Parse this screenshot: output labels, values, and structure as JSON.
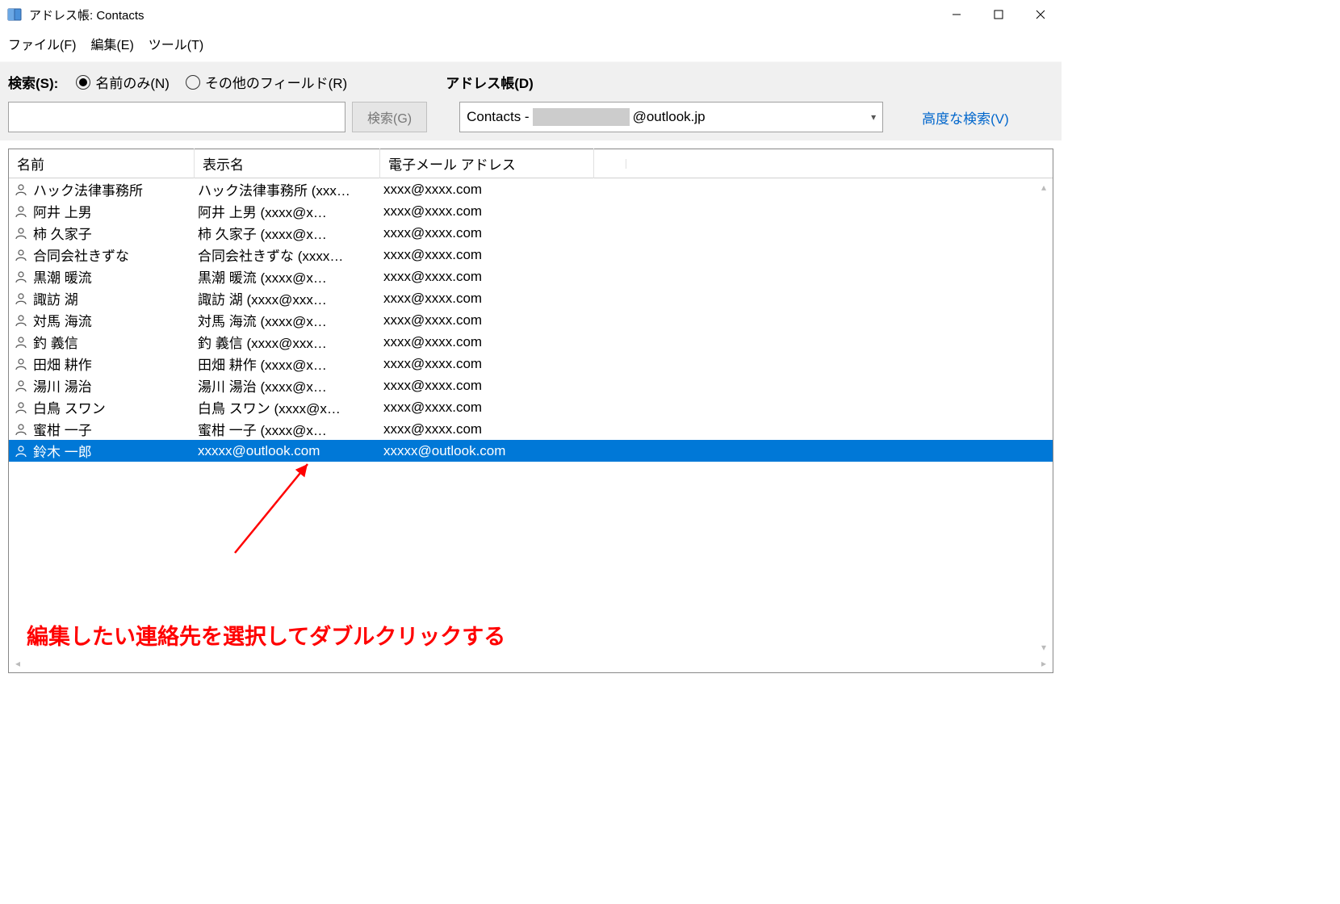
{
  "window": {
    "title": "アドレス帳: Contacts"
  },
  "menu": {
    "file": "ファイル(F)",
    "edit": "編集(E)",
    "tool": "ツール(T)"
  },
  "toolbar": {
    "search_label": "検索(S):",
    "radio_name_only": "名前のみ(N)",
    "radio_other_fields": "その他のフィールド(R)",
    "addressbook_label": "アドレス帳(D)",
    "search_button": "検索(G)",
    "dropdown_prefix": "Contacts - ",
    "dropdown_suffix": "@outlook.jp",
    "advanced_link": "高度な検索(V)"
  },
  "columns": {
    "name": "名前",
    "display": "表示名",
    "email": "電子メール アドレス"
  },
  "contacts": [
    {
      "name": "ハック法律事務所",
      "display": "ハック法律事務所 (xxx…",
      "email": "xxxx@xxxx.com",
      "selected": false
    },
    {
      "name": "阿井  上男",
      "display": "阿井  上男 (xxxx@x…",
      "email": "xxxx@xxxx.com",
      "selected": false
    },
    {
      "name": "柿  久家子",
      "display": "柿  久家子 (xxxx@x…",
      "email": "xxxx@xxxx.com",
      "selected": false
    },
    {
      "name": "合同会社きずな",
      "display": "合同会社きずな (xxxx…",
      "email": "xxxx@xxxx.com",
      "selected": false
    },
    {
      "name": "黒潮  暖流",
      "display": "黒潮  暖流 (xxxx@x…",
      "email": "xxxx@xxxx.com",
      "selected": false
    },
    {
      "name": "諏訪  湖",
      "display": "諏訪  湖 (xxxx@xxx…",
      "email": "xxxx@xxxx.com",
      "selected": false
    },
    {
      "name": "対馬  海流",
      "display": "対馬  海流 (xxxx@x…",
      "email": "xxxx@xxxx.com",
      "selected": false
    },
    {
      "name": "釣  義信",
      "display": "釣  義信 (xxxx@xxx…",
      "email": "xxxx@xxxx.com",
      "selected": false
    },
    {
      "name": "田畑  耕作",
      "display": "田畑  耕作 (xxxx@x…",
      "email": "xxxx@xxxx.com",
      "selected": false
    },
    {
      "name": "湯川  湯治",
      "display": "湯川  湯治 (xxxx@x…",
      "email": "xxxx@xxxx.com",
      "selected": false
    },
    {
      "name": "白鳥  スワン",
      "display": "白鳥  スワン (xxxx@x…",
      "email": "xxxx@xxxx.com",
      "selected": false
    },
    {
      "name": "蜜柑  一子",
      "display": "蜜柑  一子 (xxxx@x…",
      "email": "xxxx@xxxx.com",
      "selected": false
    },
    {
      "name": "鈴木 一郎",
      "display": "xxxxx@outlook.com",
      "email": "xxxxx@outlook.com",
      "selected": true
    }
  ],
  "annotation": {
    "text": "編集したい連絡先を選択してダブルクリックする"
  }
}
